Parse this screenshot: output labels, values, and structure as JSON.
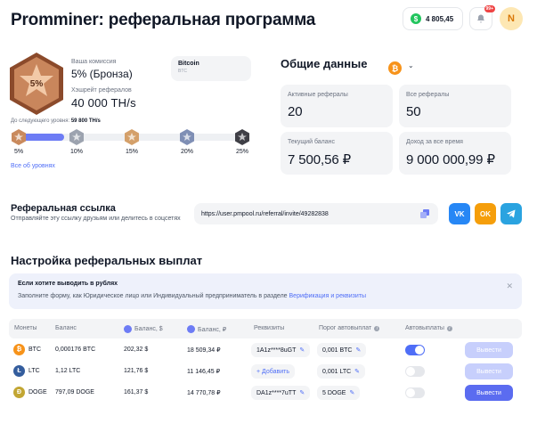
{
  "header": {
    "title": "Promminer: реферальная программа",
    "balance": "4 805,45",
    "notifications_badge": "99+",
    "avatar_initial": "N"
  },
  "level": {
    "badge_label": "5%",
    "commission_label": "Ваша комиссия",
    "commission_value": "5% (Бронза)",
    "hashrate_label": "Хэшрейт рефералов",
    "hashrate_value": "40 000 TH/s",
    "next_level_label": "До следующего уровня:",
    "next_level_value": "59 800 TH/s",
    "progress": 0.2,
    "levels": [
      {
        "label": "5%",
        "color": "#c98a5d"
      },
      {
        "label": "10%",
        "color": "#9ca3af"
      },
      {
        "label": "15%",
        "color": "#d4a06a"
      },
      {
        "label": "20%",
        "color": "#7f8fb5"
      },
      {
        "label": "25%",
        "color": "#3f3f46"
      }
    ],
    "all_levels_link": "Все об уровнях"
  },
  "coin_select": {
    "name": "Bitcoin",
    "ticker": "BTC",
    "icon_symbol": "₿"
  },
  "stats": {
    "title": "Общие данные",
    "active_label": "Активные рефералы",
    "active_value": "20",
    "all_label": "Все рефералы",
    "all_value": "50",
    "balance_label": "Текущий баланс",
    "balance_value": "7 500,56 ₽",
    "income_label": "Доход за все время",
    "income_value": "9 000 000,99 ₽"
  },
  "referral": {
    "title": "Реферальная ссылка",
    "subtitle": "Отправляйте эту ссылку друзьям или делитесь в соцсетях",
    "link": "https://user.pmpool.ru/referral/invite/49282838",
    "vk_label": "VK",
    "ok_label": "OK"
  },
  "payouts": {
    "title": "Настройка реферальных выплат",
    "notice_title": "Если хотите выводить в рублях",
    "notice_text": "Заполните форму, как Юридическое лицо или Индивидуальный предприниматель в разделе",
    "notice_link": "Верификация и реквизиты",
    "columns": {
      "coins": "Монеты",
      "balance": "Баланс",
      "balance_usd": "Баланс, $",
      "balance_rub": "Баланс, ₽",
      "requisites": "Реквизиты",
      "threshold": "Порог автовыплат",
      "auto": "Автовыплаты"
    },
    "rows": [
      {
        "coin": "BTC",
        "coin_color": "#f7931a",
        "coin_symbol": "₿",
        "balance": "0,000176 BTC",
        "usd": "202,32 $",
        "rub": "18 509,34 ₽",
        "requisite": "1A1z****8uGT",
        "threshold": "0,001 BTC",
        "auto": true,
        "withdraw": "Вывести",
        "withdraw_active": false
      },
      {
        "coin": "LTC",
        "coin_color": "#345d9d",
        "coin_symbol": "Ł",
        "balance": "1,12 LTC",
        "usd": "121,76 $",
        "rub": "11 146,45 ₽",
        "requisite": "+ Добавить",
        "threshold": "0,001 LTC",
        "auto": false,
        "withdraw": "Вывести",
        "withdraw_active": false
      },
      {
        "coin": "DOGE",
        "coin_color": "#c2a633",
        "coin_symbol": "Ð",
        "balance": "797,09 DOGE",
        "usd": "161,37 $",
        "rub": "14 770,78 ₽",
        "requisite": "DA1z****7uTT",
        "threshold": "5 DOGE",
        "auto": false,
        "withdraw": "Вывести",
        "withdraw_active": true
      }
    ]
  }
}
